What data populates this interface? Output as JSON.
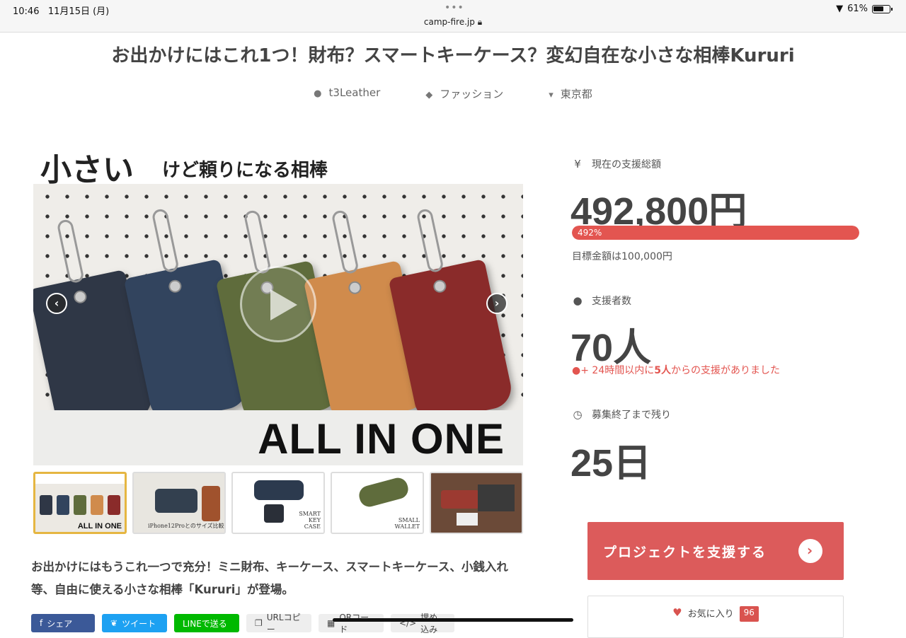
{
  "status_bar": {
    "time": "10:46",
    "date": "11月15日 (月)",
    "url": "camp-fire.jp",
    "battery": "61%"
  },
  "project": {
    "title": "お出かけにはこれ1つ！財布？スマートキーケース？変幻自在な小さな相棒Kururi",
    "owner": "t3Leather",
    "category": "ファッション",
    "location": "東京都"
  },
  "hero": {
    "heading_big": "小さい",
    "heading_small": "けど頼りになる相棒",
    "caption": "ALL IN ONE",
    "wallet_colors": [
      "#2f3746",
      "#32445e",
      "#5f6c3c",
      "#d08b4c",
      "#8a2b2a"
    ]
  },
  "thumbnails": [
    {
      "label": "ALL IN ONE"
    },
    {
      "label": "iPhone12Proとのサイズ比較"
    },
    {
      "label": "SMART KEY CASE"
    },
    {
      "label": "SMALL WALLET"
    },
    {
      "label": ""
    }
  ],
  "description": "お出かけにはもうこれ一つで充分！ミニ財布、キーケース、スマートキーケース、小銭入れ等、自由に使える小さな相棒「Kururi」が登場。",
  "share": {
    "facebook": "シェア",
    "twitter": "ツイート",
    "line": "LINEで送る",
    "copy": "URLコピー",
    "qr": "QRコード",
    "embed": "埋め込み"
  },
  "stats": {
    "total_label": "現在の支援総額",
    "total_value": "492,800円",
    "percent_text": "492%",
    "percent": 100,
    "goal": "目標金額は100,000円",
    "backers_label": "支援者数",
    "backers_value": "70人",
    "recent_prefix": "24時間以内に",
    "recent_count": "5人",
    "recent_suffix": "からの支援がありました",
    "remaining_label": "募集終了まで残り",
    "remaining_value": "25日"
  },
  "actions": {
    "support": "プロジェクトを支援する",
    "favorite": "お気に入り",
    "favorite_count": "96"
  },
  "colors": {
    "accent": "#dc5b5b",
    "progress": "#e35550"
  }
}
